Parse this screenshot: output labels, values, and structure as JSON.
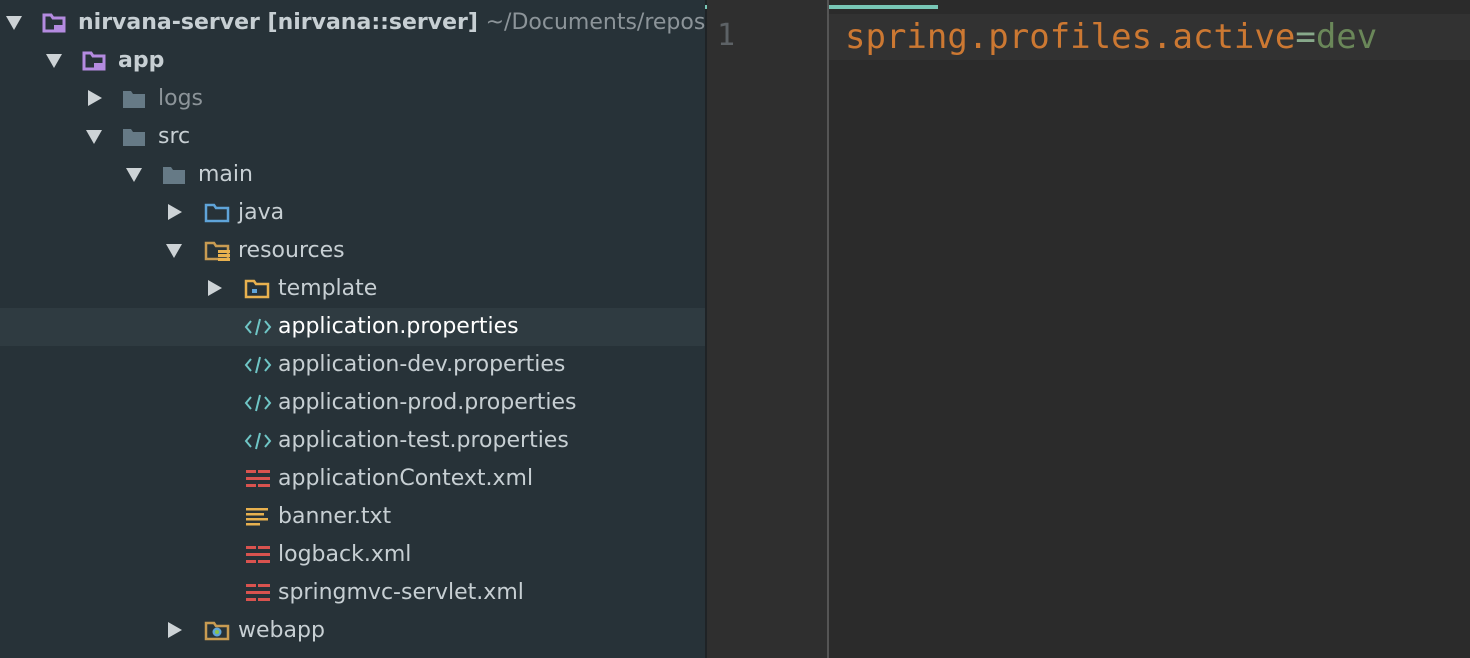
{
  "project_tree": {
    "root": {
      "name": "nirvana-server [nirvana::server]",
      "path": "~/Documents/reposi"
    },
    "items": [
      {
        "label": "app",
        "type": "module"
      },
      {
        "label": "logs",
        "type": "folder"
      },
      {
        "label": "src",
        "type": "folder"
      },
      {
        "label": "main",
        "type": "folder"
      },
      {
        "label": "java",
        "type": "source-folder"
      },
      {
        "label": "resources",
        "type": "resources-folder"
      },
      {
        "label": "template",
        "type": "folder"
      },
      {
        "label": "application.properties",
        "type": "properties-file",
        "selected": true
      },
      {
        "label": "application-dev.properties",
        "type": "properties-file"
      },
      {
        "label": "application-prod.properties",
        "type": "properties-file"
      },
      {
        "label": "application-test.properties",
        "type": "properties-file"
      },
      {
        "label": "applicationContext.xml",
        "type": "xml-file"
      },
      {
        "label": "banner.txt",
        "type": "text-file"
      },
      {
        "label": "logback.xml",
        "type": "xml-file"
      },
      {
        "label": "springmvc-servlet.xml",
        "type": "xml-file"
      },
      {
        "label": "webapp",
        "type": "web-folder"
      }
    ]
  },
  "editor": {
    "line_number": "1",
    "code": {
      "key": "spring.profiles.active",
      "equals": "=",
      "value": "dev"
    }
  },
  "colors": {
    "tree_background": "#273238",
    "editor_background": "#2b2b2b",
    "key": "#cc7832",
    "value": "#6a8759",
    "accent": "#78c6b6"
  }
}
